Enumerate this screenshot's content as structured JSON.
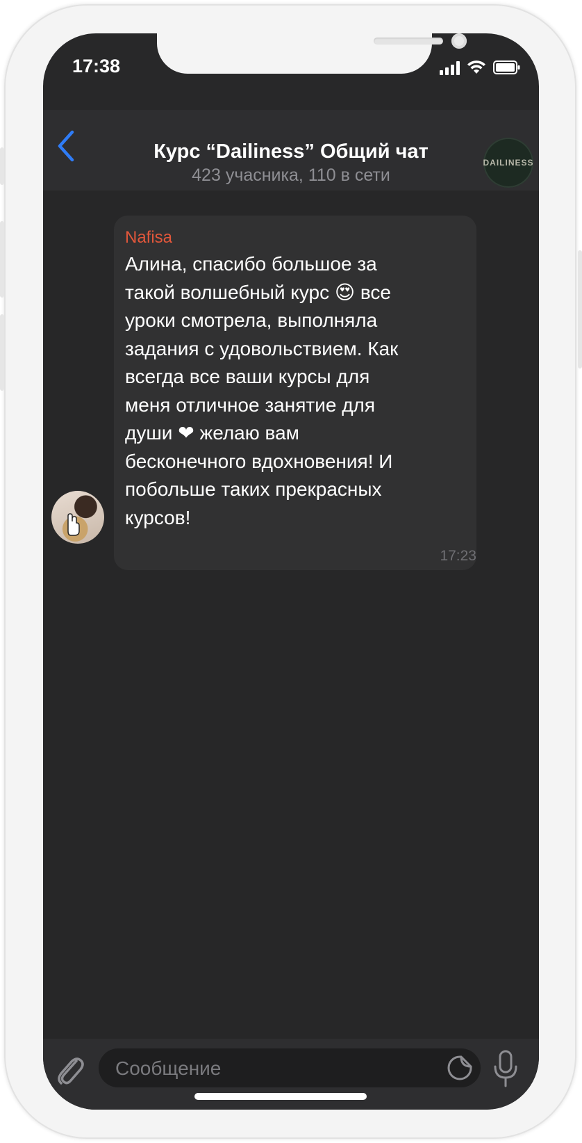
{
  "status_bar": {
    "time": "17:38",
    "icons": [
      "cellular-signal-icon",
      "wifi-icon",
      "battery-icon"
    ]
  },
  "header": {
    "back_icon": "chevron-left-icon",
    "title": "Курс “Dailiness” Общий чат",
    "subtitle": "423 учасника, 110 в сети",
    "avatar_text": "DAILINESS"
  },
  "messages": [
    {
      "sender": "Nafisa",
      "text": "Алина, спасибо большое за\nтакой волшебный курс 😍 все\nуроки смотрела, выполняла\nзадания с удовольствием. Как\nвсегда все ваши курсы для\nменя отличное занятие для\nдуши ❤ желаю вам\nбесконечного вдохновения! И\nпобольше таких прекрасных\nкурсов!",
      "time": "17:23"
    }
  ],
  "input_bar": {
    "placeholder": "Сообщение",
    "icons": [
      "paperclip-icon",
      "sticker-icon",
      "microphone-icon"
    ]
  },
  "colors": {
    "accent": "#2f7cf6",
    "sender_name": "#e2573b",
    "background": "#272728",
    "bubble": "#313132"
  }
}
